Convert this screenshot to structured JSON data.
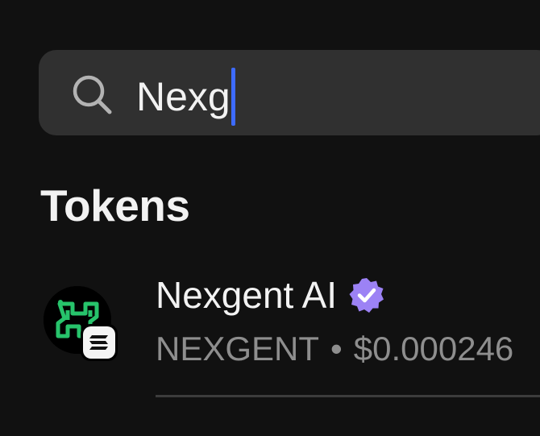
{
  "search": {
    "query": "Nexg"
  },
  "section": {
    "title": "Tokens"
  },
  "tokens": [
    {
      "name": "Nexgent AI",
      "symbol": "NEXGENT",
      "separator": "•",
      "price": "$0.000246",
      "verified": true,
      "logo_icon": "nexgent-logo-icon",
      "chain_icon": "solana-icon"
    }
  ],
  "colors": {
    "background": "#111111",
    "search_bg": "#303030",
    "caret": "#3d6bff",
    "verified": "#9c82f5",
    "logo_green": "#27c36b",
    "secondary_text": "#8e8e8e"
  }
}
